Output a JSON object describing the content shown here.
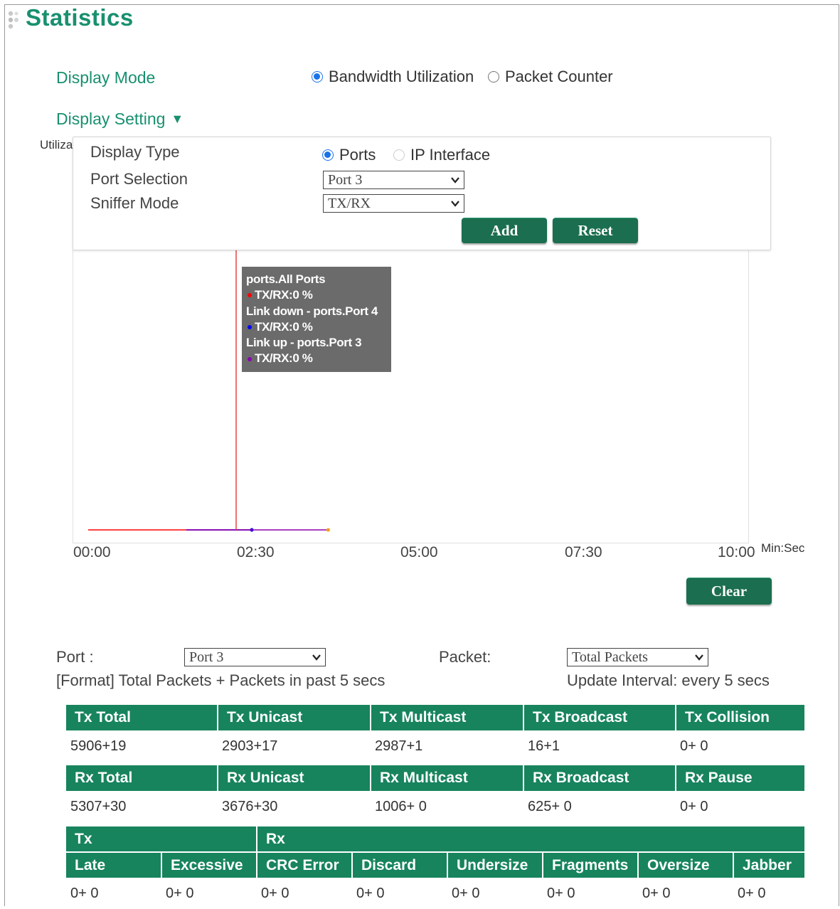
{
  "page": {
    "title": "Statistics"
  },
  "display_mode": {
    "label": "Display Mode",
    "options": [
      {
        "label": "Bandwidth Utilization",
        "checked": true
      },
      {
        "label": "Packet Counter",
        "checked": false
      }
    ]
  },
  "display_setting": {
    "label": "Display Setting",
    "display_type": {
      "label": "Display Type",
      "options": [
        {
          "label": "Ports",
          "checked": true
        },
        {
          "label": "IP Interface",
          "checked": false,
          "disabled": true
        }
      ]
    },
    "port_selection": {
      "label": "Port Selection",
      "value": "Port 3"
    },
    "sniffer_mode": {
      "label": "Sniffer Mode",
      "value": "TX/RX"
    },
    "add_label": "Add",
    "reset_label": "Reset"
  },
  "chart": {
    "ylabel_partial": "Utiliza",
    "x_unit": "Min:Sec",
    "x_ticks": [
      "00:00",
      "02:30",
      "05:00",
      "07:30",
      "10:00"
    ],
    "tooltip": {
      "lines": [
        {
          "text": "ports.All Ports",
          "dot": null
        },
        {
          "text": "TX/RX:0 %",
          "dot": "#ff0000"
        },
        {
          "text": "Link down - ports.Port 4",
          "dot": null
        },
        {
          "text": "TX/RX:0 %",
          "dot": "#0000ff"
        },
        {
          "text": "Link up - ports.Port 3",
          "dot": null
        },
        {
          "text": "TX/RX:0 %",
          "dot": "#8b00b0"
        }
      ]
    },
    "clear_label": "Clear"
  },
  "chart_data": {
    "type": "line",
    "x_unit": "Min:Sec",
    "xlim": [
      "00:00",
      "10:00"
    ],
    "x_ticks": [
      "00:00",
      "02:30",
      "05:00",
      "07:30",
      "10:00"
    ],
    "cursor_x": "02:30",
    "series": [
      {
        "name": "ports.All Ports",
        "color": "#ff0000",
        "x": [
          "00:00",
          "02:30"
        ],
        "y": [
          0,
          0
        ]
      },
      {
        "name": "ports.Port 4",
        "color": "#0000ff",
        "x": [
          "01:30",
          "02:30"
        ],
        "y": [
          0,
          0
        ]
      },
      {
        "name": "ports.Port 3",
        "color": "#8b00b0",
        "x": [
          "01:30",
          "03:40"
        ],
        "y": [
          0,
          0
        ]
      }
    ]
  },
  "packet": {
    "port_label": "Port :",
    "port_value": "Port 3",
    "packet_label": "Packet:",
    "packet_value": "Total Packets",
    "format_text": "[Format] Total Packets + Packets in past 5 secs",
    "update_text": "Update Interval: every 5 secs"
  },
  "tx_table": {
    "headers": [
      "Tx Total",
      "Tx Unicast",
      "Tx Multicast",
      "Tx Broadcast",
      "Tx Collision"
    ],
    "values": [
      "5906+19",
      "2903+17",
      "2987+1",
      "16+1",
      "0+ 0"
    ]
  },
  "rx_table": {
    "headers": [
      "Rx Total",
      "Rx Unicast",
      "Rx Multicast",
      "Rx Broadcast",
      "Rx Pause"
    ],
    "values": [
      "5307+30",
      "3676+30",
      "1006+ 0",
      "625+ 0",
      "0+ 0"
    ]
  },
  "err_table": {
    "groups": [
      "Tx",
      "Rx"
    ],
    "headers": [
      "Late",
      "Excessive",
      "CRC Error",
      "Discard",
      "Undersize",
      "Fragments",
      "Oversize",
      "Jabber"
    ],
    "values": [
      "0+ 0",
      "0+ 0",
      "0+ 0",
      "0+ 0",
      "0+ 0",
      "0+ 0",
      "0+ 0",
      "0+ 0"
    ]
  },
  "colors": {
    "accent": "#18906f",
    "header_bg": "#17845d",
    "button_bg": "#1b6e4f",
    "tooltip_bg": "#6b6b6b"
  }
}
